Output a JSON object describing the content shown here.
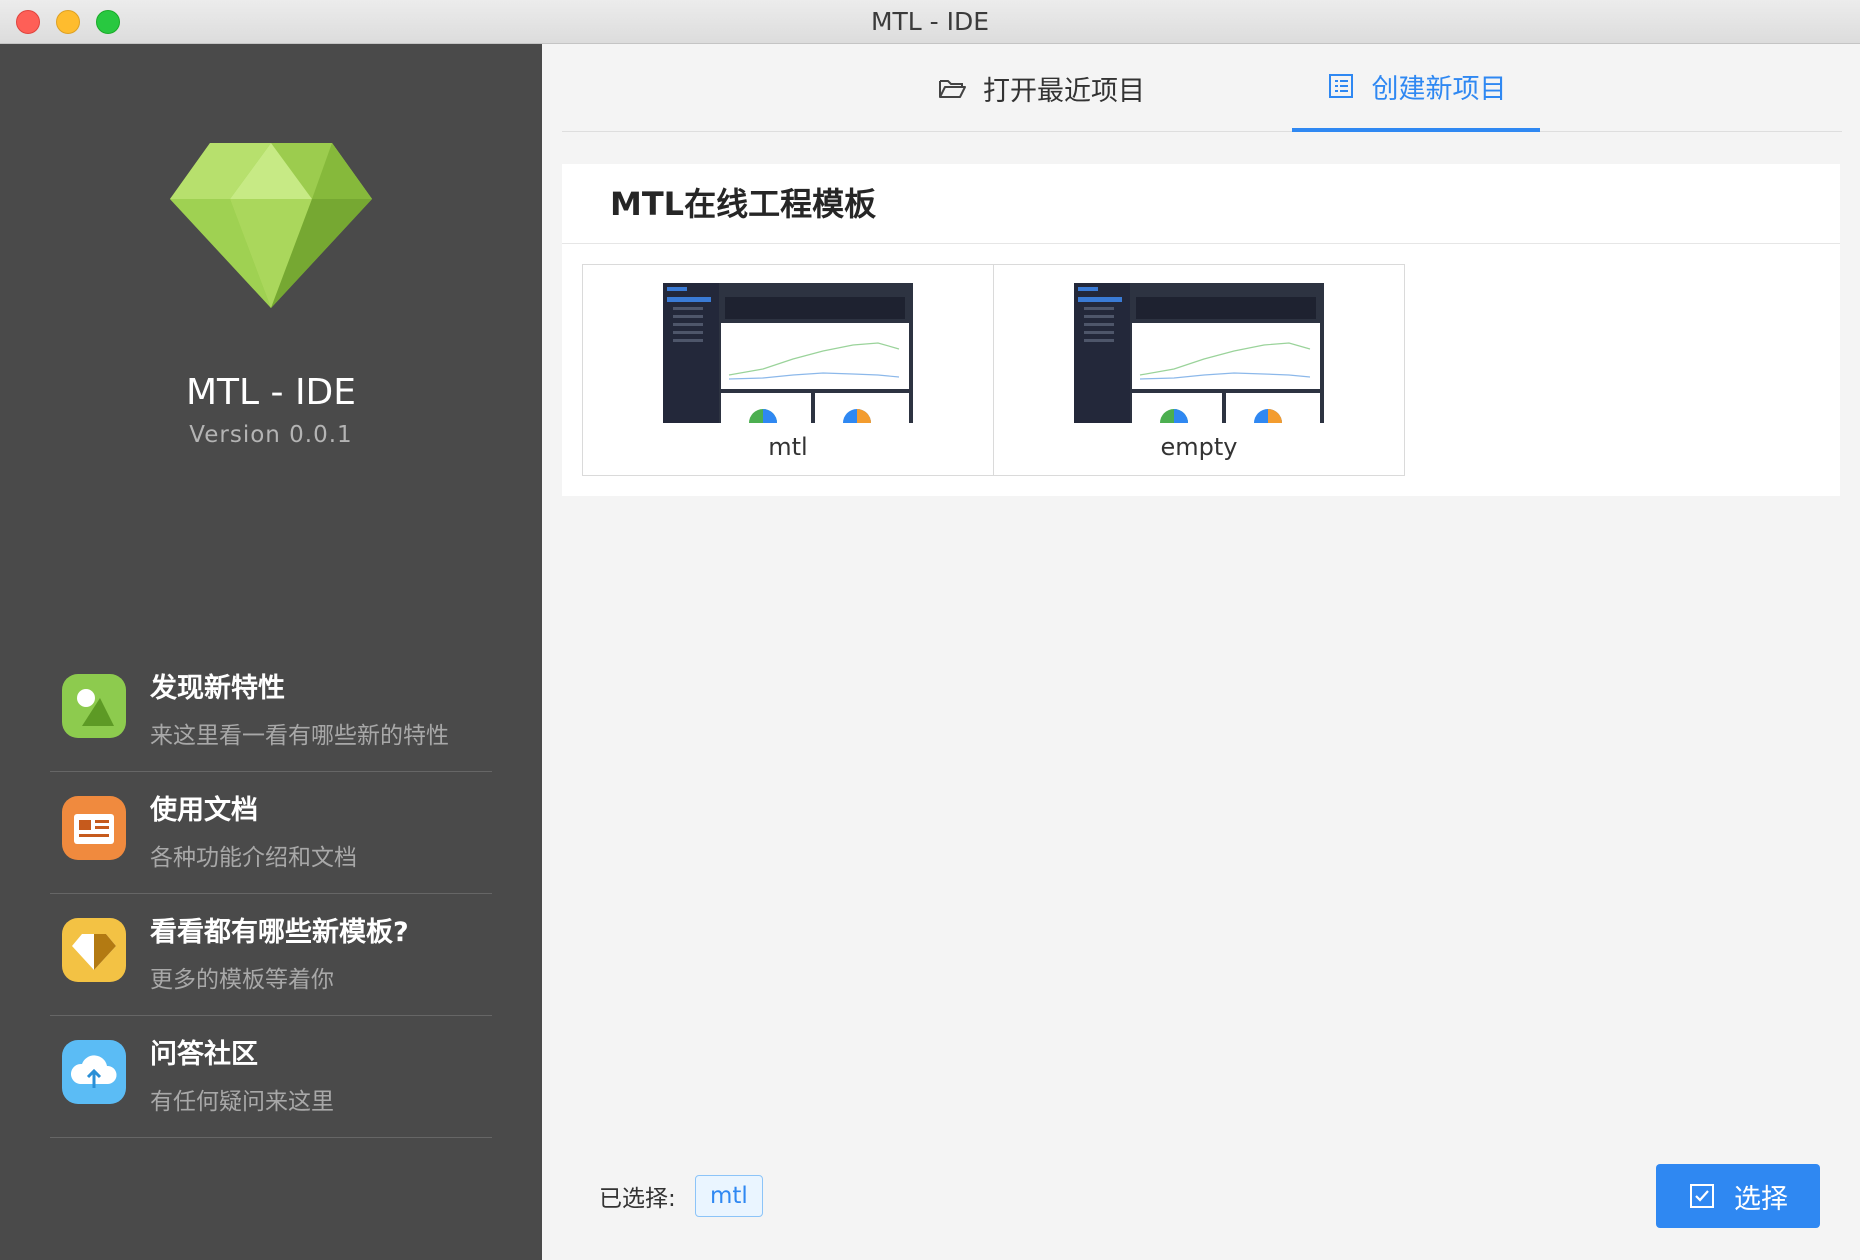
{
  "window": {
    "title": "MTL - IDE"
  },
  "sidebar": {
    "app_name": "MTL - IDE",
    "version": "Version 0.0.1",
    "features": [
      {
        "title": "发现新特性",
        "desc": "来这里看一看有哪些新的特性",
        "icon": "image-icon",
        "color": "#8dcb4e"
      },
      {
        "title": "使用文档",
        "desc": "各种功能介绍和文档",
        "icon": "document-icon",
        "color": "#f08a3e"
      },
      {
        "title": "看看都有哪些新模板?",
        "desc": "更多的模板等着你",
        "icon": "gem-icon",
        "color": "#f3c244"
      },
      {
        "title": "问答社区",
        "desc": "有任何疑问来这里",
        "icon": "cloud-upload-icon",
        "color": "#5bbcf5"
      }
    ]
  },
  "tabs": [
    {
      "label": "打开最近项目",
      "icon": "folder-open-icon",
      "active": false
    },
    {
      "label": "创建新项目",
      "icon": "list-icon",
      "active": true
    }
  ],
  "templates": {
    "title": "MTL在线工程模板",
    "items": [
      {
        "name": "mtl"
      },
      {
        "name": "empty"
      }
    ]
  },
  "footer": {
    "selected_label": "已选择:",
    "selected_value": "mtl",
    "select_button": "选择"
  },
  "colors": {
    "accent": "#2f88f2",
    "sidebar_bg": "#4a4a4a"
  }
}
